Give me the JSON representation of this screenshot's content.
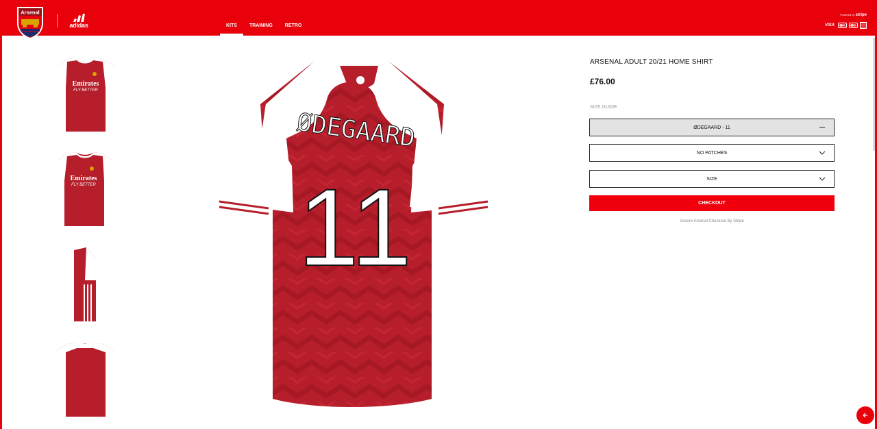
{
  "header": {
    "crest_text": "Arsenal",
    "brand_wordmark": "adidas",
    "nav": [
      {
        "label": "KITS",
        "active": true
      },
      {
        "label": "TRAINING",
        "active": false
      },
      {
        "label": "RETRO",
        "active": false
      }
    ],
    "powered_by": "Powered by",
    "powered_brand": "stripe",
    "payments": [
      "VISA",
      "mastercard-icon",
      "maestro-icon",
      "card-icon"
    ]
  },
  "main_image": {
    "player_name": "ØDEGAARD",
    "player_number": "11",
    "sponsor": "Emirates",
    "sponsor_tagline": "FLY BETTER"
  },
  "product": {
    "title": "ARSENAL ADULT 20/21 HOME SHIRT",
    "price": "£76.00",
    "size_guide": "SIZE GUIDE",
    "print_selection": "ØDEGAARD - 11",
    "patches_selection": "NO PATCHES",
    "size_selection": "SIZE",
    "checkout_label": "CHECKOUT",
    "secure_note": "Secure Arsenal Checkout By Stripe"
  },
  "colors": {
    "brand_red": "#e8000b",
    "shirt_red": "#b51e2a",
    "shirt_white": "#ffffff"
  }
}
